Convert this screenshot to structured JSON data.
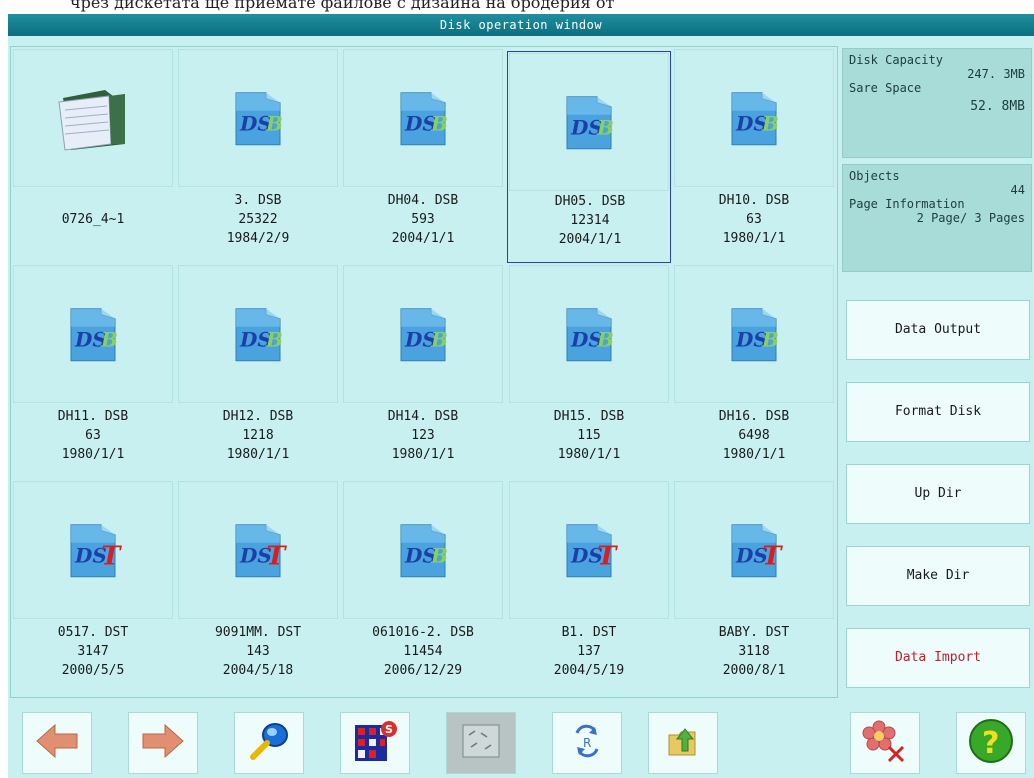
{
  "window": {
    "title": "Disk operation window"
  },
  "top_strip_text": "чрез дискетата ще приемате файлове с дизайна на бродерия от",
  "files": [
    {
      "name": "0726_4~1",
      "size": "",
      "date": "",
      "icon": "folder-icon"
    },
    {
      "name": "3. DSB",
      "size": "25322",
      "date": "1984/2/9",
      "icon": "dsb-file-icon"
    },
    {
      "name": "DH04. DSB",
      "size": "593",
      "date": "2004/1/1",
      "icon": "dsb-file-icon"
    },
    {
      "name": "DH05. DSB",
      "size": "12314",
      "date": "2004/1/1",
      "icon": "dsb-file-icon",
      "selected": true
    },
    {
      "name": "DH10. DSB",
      "size": "63",
      "date": "1980/1/1",
      "icon": "dsb-file-icon"
    },
    {
      "name": "DH11. DSB",
      "size": "63",
      "date": "1980/1/1",
      "icon": "dsb-file-icon"
    },
    {
      "name": "DH12. DSB",
      "size": "1218",
      "date": "1980/1/1",
      "icon": "dsb-file-icon"
    },
    {
      "name": "DH14. DSB",
      "size": "123",
      "date": "1980/1/1",
      "icon": "dsb-file-icon"
    },
    {
      "name": "DH15. DSB",
      "size": "115",
      "date": "1980/1/1",
      "icon": "dsb-file-icon"
    },
    {
      "name": "DH16. DSB",
      "size": "6498",
      "date": "1980/1/1",
      "icon": "dsb-file-icon"
    },
    {
      "name": "0517. DST",
      "size": "3147",
      "date": "2000/5/5",
      "icon": "dst-file-icon"
    },
    {
      "name": "9091MM. DST",
      "size": "143",
      "date": "2004/5/18",
      "icon": "dst-file-icon"
    },
    {
      "name": "061016-2. DSB",
      "size": "11454",
      "date": "2006/12/29",
      "icon": "dsb-file-icon"
    },
    {
      "name": "B1. DST",
      "size": "137",
      "date": "2004/5/19",
      "icon": "dst-file-icon"
    },
    {
      "name": "BABY. DST",
      "size": "3118",
      "date": "2000/8/1",
      "icon": "dst-file-icon"
    }
  ],
  "disk_info": {
    "capacity_label": "Disk Capacity",
    "capacity_value": "247. 3MB",
    "spare_label": "Sare Space",
    "spare_value": "52. 8MB"
  },
  "objects_info": {
    "objects_label": "Objects",
    "objects_value": "44",
    "page_label": "Page Information",
    "page_value": "2 Page/ 3 Pages"
  },
  "buttons": {
    "data_output": "Data Output",
    "format_disk": "Format Disk",
    "up_dir": "Up Dir",
    "make_dir": "Make Dir",
    "data_import": "Data Import"
  },
  "toolbar": [
    {
      "icon": "arrow-left-icon"
    },
    {
      "icon": "arrow-right-icon"
    },
    {
      "icon": "magnifier-icon"
    },
    {
      "icon": "grid-select-icon"
    },
    {
      "icon": "pattern-preview-icon"
    },
    {
      "icon": "rotate-icon"
    },
    {
      "icon": "folder-up-icon"
    },
    {
      "icon": "delete-flower-icon"
    },
    {
      "icon": "help-icon"
    }
  ],
  "colors": {
    "title_bar": "#138393",
    "panel_bg": "#c8f0f0",
    "info_bg": "#a8dcd8",
    "selection_border": "#2a3fb0",
    "import_text": "#c0202a"
  }
}
